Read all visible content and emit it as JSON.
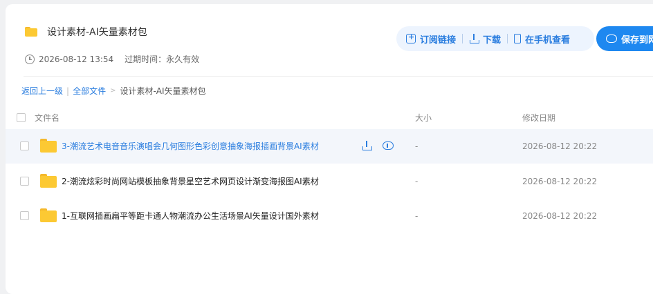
{
  "folder": {
    "title": "设计素材-AI矢量素材包",
    "created": "2026-08-12 13:54",
    "expire_label": "过期时间：",
    "expire_value": "永久有效"
  },
  "actions": {
    "subscribe": "订阅链接",
    "download": "下载",
    "phone": "在手机查看",
    "save": "保存到网盘"
  },
  "breadcrumb": {
    "back": "返回上一级",
    "sep": "|",
    "all": "全部文件",
    "gt": ">",
    "current": "设计素材-AI矢量素材包"
  },
  "table": {
    "headers": {
      "name": "文件名",
      "size": "大小",
      "date": "修改日期"
    },
    "rows": [
      {
        "name": "3-潮流艺术电音音乐演唱会几何图形色彩创意抽象海报插画背景AI素材",
        "size": "-",
        "date": "2026-08-12 20:22"
      },
      {
        "name": "2-潮流炫彩时尚网站模板抽象背景星空艺术网页设计渐变海报图AI素材",
        "size": "-",
        "date": "2026-08-12 20:22"
      },
      {
        "name": "1-互联网插画扁平等距卡通人物潮流办公生活场景AI矢量设计国外素材",
        "size": "-",
        "date": "2026-08-12 20:22"
      }
    ]
  },
  "colors": {
    "accent": "#1e88f0",
    "link": "#2a7ddf",
    "folder": "#fcc933"
  }
}
